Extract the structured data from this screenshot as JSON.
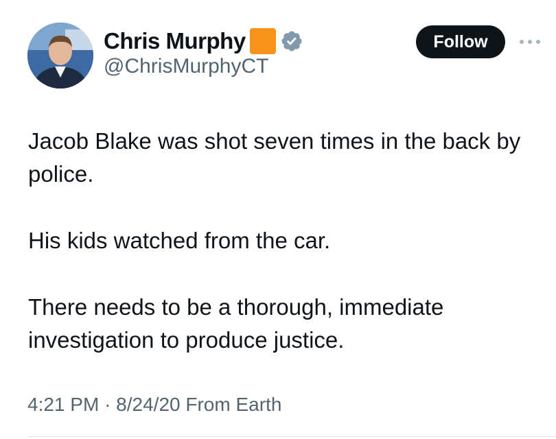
{
  "author": {
    "display_name": "Chris Murphy",
    "handle": "@ChrisMurphyCT",
    "name_emoji": "orange-square-emoji",
    "verified_icon": "verified-badge-icon",
    "verified_color": "#829aab"
  },
  "actions": {
    "follow_label": "Follow",
    "more_icon": "more-options-icon"
  },
  "tweet": {
    "paragraphs": [
      "Jacob Blake was shot seven times in the back by police.",
      "His kids watched from the car.",
      "There needs to be a thorough, immediate investigation to produce justice."
    ]
  },
  "meta": {
    "time": "4:21 PM",
    "separator": "·",
    "date": "8/24/20",
    "location": "From Earth"
  },
  "colors": {
    "text_primary": "#0f1419",
    "text_secondary": "#536471",
    "follow_bg": "#0f1419",
    "emoji_orange": "#f7931a"
  }
}
